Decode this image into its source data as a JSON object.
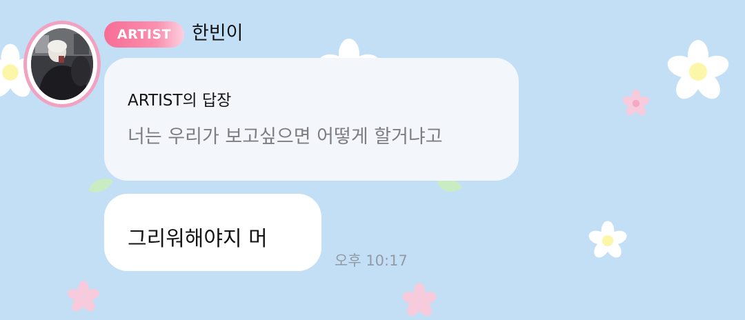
{
  "sender": {
    "badge": "ARTIST",
    "name": "한빈이",
    "avatar_icon": "profile-photo"
  },
  "reply": {
    "title": "ARTIST의 답장",
    "quoted_text": "너는 우리가 보고싶으면 어떻게 할거냐고"
  },
  "message": {
    "text": "그리워해야지 머",
    "time": "오후 10:17"
  },
  "colors": {
    "background": "#c2dff6",
    "badge_pink": "#f76d95",
    "avatar_ring": "#f2a2c0",
    "reply_bubble": "#f3f6fb",
    "message_bubble": "#ffffff",
    "timestamp": "#939aa3"
  }
}
